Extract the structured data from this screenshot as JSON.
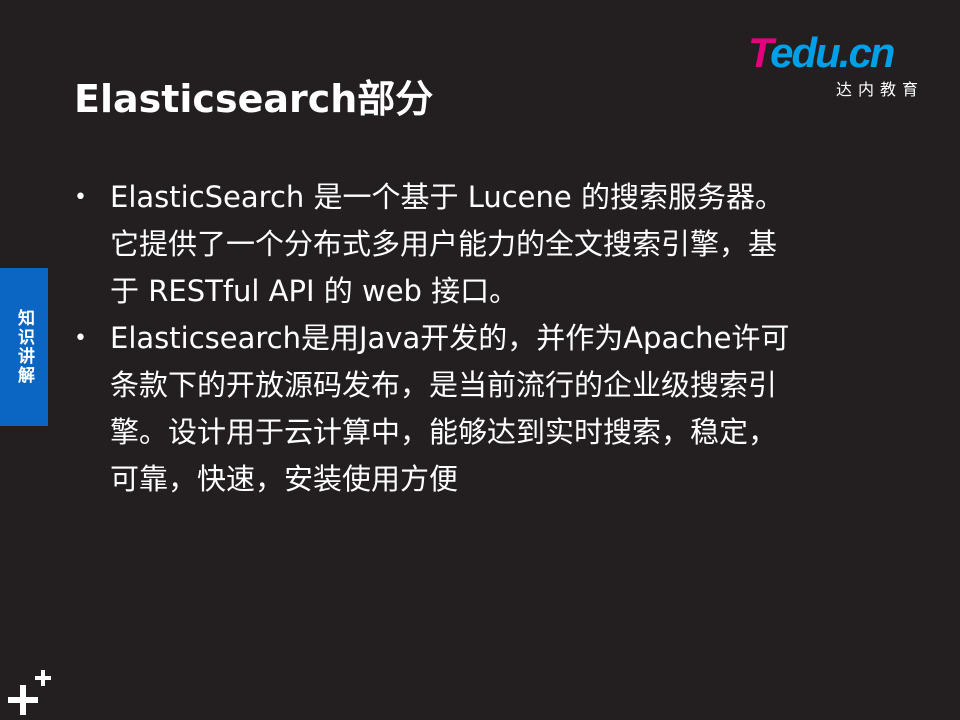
{
  "slide": {
    "title": "Elasticsearch部分",
    "logo": {
      "letter_t": "T",
      "word_rest": "edu.cn",
      "subtitle": "达内教育",
      "colors": {
        "t": "#e4007f",
        "rest": "#00a0e9"
      }
    },
    "side_tab": {
      "label": "知识讲解",
      "color": "#0b66c3"
    },
    "bullet_symbol": "•",
    "bullets": [
      {
        "lines": [
          "ElasticSearch 是一个基于 Lucene 的搜索服务器。",
          "它提供了一个分布式多用户能力的全文搜索引擎，基",
          "于 RESTful API 的 web 接口。"
        ]
      },
      {
        "lines": [
          "Elasticsearch是用Java开发的，并作为Apache许可",
          "条款下的开放源码发布，是当前流行的企业级搜索引",
          "擎。设计用于云计算中，能够达到实时搜索，稳定，",
          "可靠，快速，安装使用方便"
        ]
      }
    ],
    "footer_icon": "plus-sparkle-icon",
    "background_color": "#231f20"
  }
}
